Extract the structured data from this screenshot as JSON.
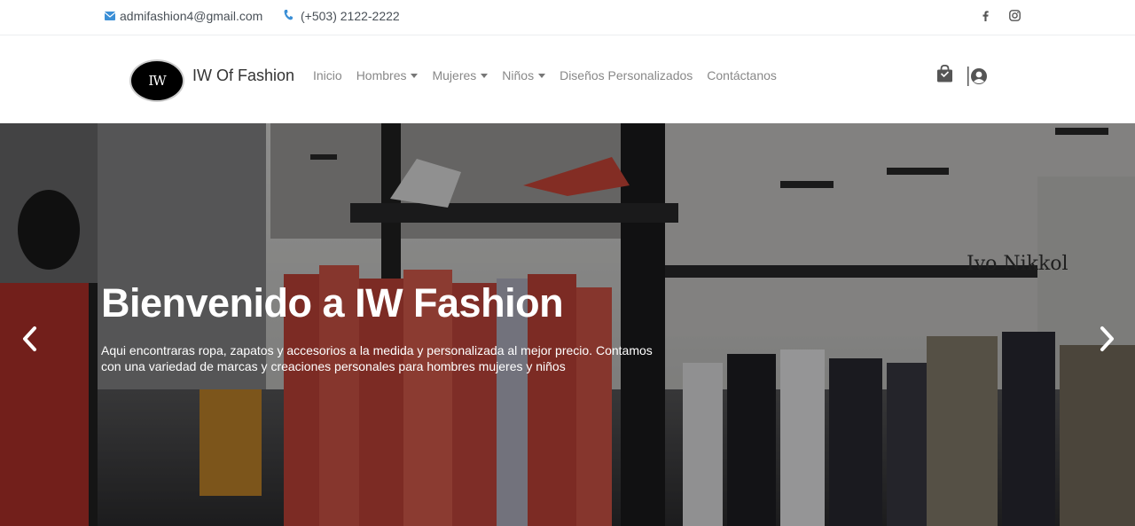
{
  "topbar": {
    "email": "admifashion4@gmail.com",
    "phone": "(+503) 2122-2222",
    "social": [
      {
        "name": "facebook-icon",
        "glyph": "f"
      },
      {
        "name": "instagram-icon",
        "glyph": ""
      }
    ]
  },
  "navbar": {
    "brand": "IW Of Fashion",
    "logo_text": "IW",
    "menu": [
      {
        "label": "Inicio",
        "dropdown": false
      },
      {
        "label": "Hombres",
        "dropdown": true
      },
      {
        "label": "Mujeres",
        "dropdown": true
      },
      {
        "label": "Niños",
        "dropdown": true
      },
      {
        "label": "Diseños Personalizados",
        "dropdown": false
      },
      {
        "label": "Contáctanos",
        "dropdown": false
      }
    ],
    "icons": [
      "shopping-bag-icon",
      "user-circle-icon"
    ]
  },
  "hero": {
    "title": "Bienvenido a IW Fashion",
    "description": "Aqui encontraras ropa, zapatos y accesorios a la medida y personalizada al mejor precio. Contamos con una variedad de marcas y creaciones personales para hombres mujeres y niños",
    "store_sign": "Ivo Nikkol"
  },
  "colors": {
    "accent": "#3b8fd6",
    "nav_text": "#888888",
    "hero_overlay": "#000000"
  }
}
